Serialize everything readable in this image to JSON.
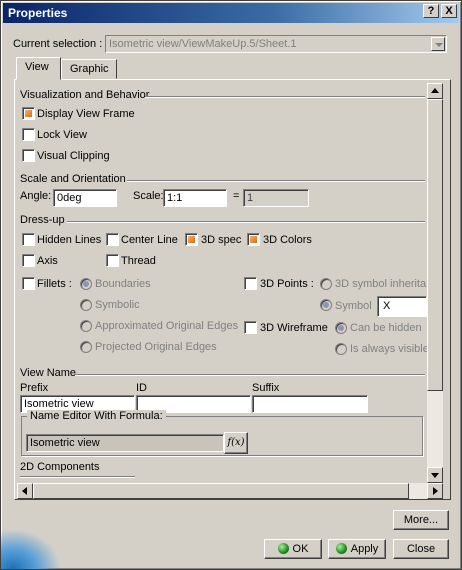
{
  "window": {
    "title": "Properties",
    "help_label": "?",
    "close_label": "X"
  },
  "selection": {
    "label": "Current selection :",
    "value": "Isometric view/ViewMakeUp.5/Sheet.1"
  },
  "tabs": [
    {
      "label": "View"
    },
    {
      "label": "Graphic"
    }
  ],
  "visualization": {
    "heading": "Visualization and Behavior",
    "display_view_frame": {
      "label": "Display View Frame",
      "checked": true
    },
    "lock_view": {
      "label": "Lock View",
      "checked": false
    },
    "visual_clipping": {
      "label": "Visual Clipping",
      "checked": false
    }
  },
  "scale": {
    "heading": "Scale and Orientation",
    "angle_label": "Angle:",
    "angle_value": "0deg",
    "scale_label": "Scale:",
    "scale_value": "1:1",
    "equals": "=",
    "result_value": "1"
  },
  "dressup": {
    "heading": "Dress-up",
    "hidden_lines": {
      "label": "Hidden Lines",
      "checked": false
    },
    "center_line": {
      "label": "Center Line",
      "checked": false
    },
    "spec_3d": {
      "label": "3D spec",
      "checked": true
    },
    "colors_3d": {
      "label": "3D Colors",
      "checked": true
    },
    "axis": {
      "label": "Axis",
      "checked": false
    },
    "thread": {
      "label": "Thread",
      "checked": false
    },
    "fillets": {
      "label": "Fillets :",
      "checked": false
    },
    "fillet_options": [
      {
        "label": "Boundaries",
        "selected": true
      },
      {
        "label": "Symbolic",
        "selected": false
      },
      {
        "label": "Approximated Original Edges",
        "selected": false
      },
      {
        "label": "Projected Original Edges",
        "selected": false
      }
    ],
    "points_3d": {
      "label": "3D Points :",
      "checked": false
    },
    "point_options": [
      {
        "label": "3D symbol inheritan",
        "selected": false
      },
      {
        "label": "Symbol",
        "selected": true
      }
    ],
    "symbol_value": "X",
    "wireframe_3d": {
      "label": "3D Wireframe",
      "checked": false
    },
    "wireframe_options": [
      {
        "label": "Can be hidden",
        "selected": true
      },
      {
        "label": "Is always visible",
        "selected": false
      }
    ]
  },
  "view_name": {
    "heading": "View Name",
    "prefix_label": "Prefix",
    "prefix_value": "Isometric view",
    "id_label": "ID",
    "id_value": "",
    "suffix_label": "Suffix",
    "suffix_value": "",
    "editor_label": "Name Editor With Formula:",
    "editor_value": "Isometric view",
    "formula_label": "f(x)"
  },
  "components": {
    "heading": "2D Components"
  },
  "buttons": {
    "more": "More...",
    "ok": "OK",
    "apply": "Apply",
    "close": "Close"
  }
}
